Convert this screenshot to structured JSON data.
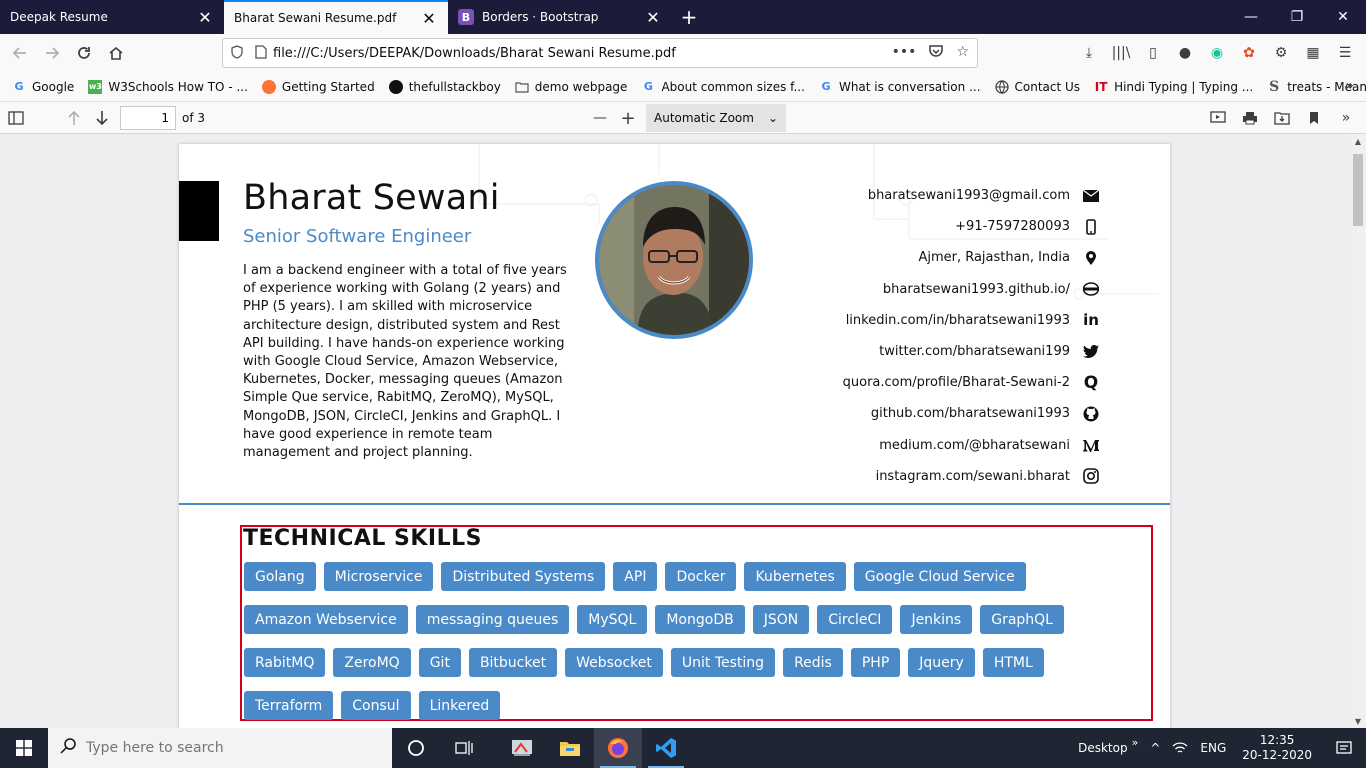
{
  "tabs": [
    {
      "label": "Deepak Resume",
      "active": false
    },
    {
      "label": "Bharat Sewani Resume.pdf",
      "active": true
    },
    {
      "label": "Borders · Bootstrap",
      "active": false
    }
  ],
  "nav": {
    "url": "file:///C:/Users/DEEPAK/Downloads/Bharat Sewani Resume.pdf"
  },
  "bookmarks": [
    {
      "label": "Google",
      "icon": "google-icon"
    },
    {
      "label": "W3Schools How TO - ...",
      "icon": "w3schools-icon"
    },
    {
      "label": "Getting Started",
      "icon": "firefox-icon"
    },
    {
      "label": "thefullstackboy",
      "icon": "github-icon"
    },
    {
      "label": "demo webpage",
      "icon": "folder-icon"
    },
    {
      "label": "About common sizes f...",
      "icon": "google-icon"
    },
    {
      "label": "What is conversation ...",
      "icon": "google-icon"
    },
    {
      "label": "Contact Us",
      "icon": "globe-icon"
    },
    {
      "label": "Hindi Typing | Typing ...",
      "icon": "it-icon"
    },
    {
      "label": "treats - Meaning in hi...",
      "icon": "s-icon"
    }
  ],
  "pdf_toolbar": {
    "page_current": "1",
    "page_total": "of 3",
    "zoom": "Automatic Zoom"
  },
  "resume": {
    "name": "Bharat Sewani",
    "title": "Senior Software Engineer",
    "summary": "I am a backend engineer with a total of five years of experience working with Golang (2 years) and PHP (5 years). I am skilled with microservice architecture design, distributed system and Rest API building. I have hands-on experience working with Google Cloud Service, Amazon Webservice, Kubernetes, Docker, messaging queues (Amazon Simple Que service, RabitMQ, ZeroMQ), MySQL, MongoDB, JSON, CircleCI, Jenkins and GraphQL. I have good experience in remote team management and project planning.",
    "contacts": [
      {
        "text": "bharatsewani1993@gmail.com",
        "icon": "email-icon"
      },
      {
        "text": "+91-7597280093",
        "icon": "phone-icon"
      },
      {
        "text": "Ajmer, Rajasthan, India",
        "icon": "location-icon"
      },
      {
        "text": "bharatsewani1993.github.io/",
        "icon": "website-icon"
      },
      {
        "text": "linkedin.com/in/bharatsewani1993",
        "icon": "linkedin-icon"
      },
      {
        "text": "twitter.com/bharatsewani199",
        "icon": "twitter-icon"
      },
      {
        "text": "quora.com/profile/Bharat-Sewani-2",
        "icon": "quora-icon"
      },
      {
        "text": "github.com/bharatsewani1993",
        "icon": "github-icon"
      },
      {
        "text": "medium.com/@bharatsewani",
        "icon": "medium-icon"
      },
      {
        "text": "instagram.com/sewani.bharat",
        "icon": "instagram-icon"
      }
    ],
    "skills_heading": "TECHNICAL SKILLS",
    "skills": [
      "Golang",
      "Microservice",
      "Distributed Systems",
      "API",
      "Docker",
      "Kubernetes",
      "Google Cloud Service",
      "Amazon Webservice",
      "messaging queues",
      "MySQL",
      "MongoDB",
      "JSON",
      "CircleCI",
      "Jenkins",
      "GraphQL",
      "RabitMQ",
      "ZeroMQ",
      "Git",
      "Bitbucket",
      "Websocket",
      "Unit Testing",
      "Redis",
      "PHP",
      "Jquery",
      "HTML",
      "Terraform",
      "Consul",
      "Linkered"
    ]
  },
  "taskbar": {
    "search_placeholder": "Type here to search",
    "desktop_label": "Desktop",
    "language": "ENG",
    "time": "12:35",
    "date": "20-12-2020"
  },
  "colors": {
    "accent": "#4a8ac9",
    "highlight_border": "#d0021b",
    "tab_strip": "#1c1b3a",
    "firefox_focus": "#0a84ff"
  }
}
